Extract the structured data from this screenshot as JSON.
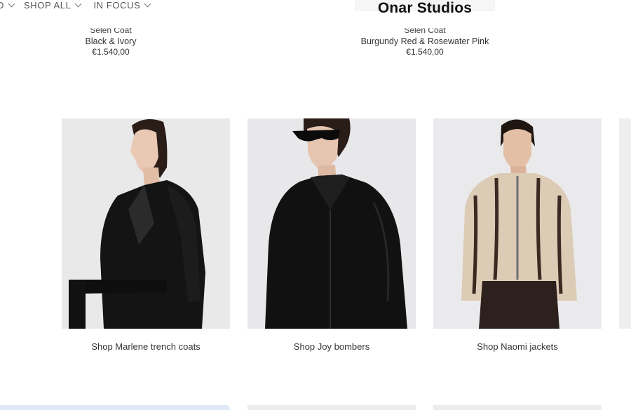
{
  "nav": {
    "items": [
      {
        "label": "D"
      },
      {
        "label": "SHOP ALL"
      },
      {
        "label": "IN FOCUS"
      }
    ]
  },
  "brand": {
    "logo": "Onar Studios"
  },
  "products": [
    {
      "name": "Selen Coat",
      "color": "Black & Ivory",
      "price": "€1.540,00"
    },
    {
      "name": "Selen Coat",
      "color": "Burgundy Red & Rosewater Pink",
      "price": "€1.540,00"
    }
  ],
  "collections": [
    {
      "caption": "Shop Marlene trench coats"
    },
    {
      "caption": "Shop Joy bombers"
    },
    {
      "caption": "Shop Naomi jackets"
    }
  ]
}
